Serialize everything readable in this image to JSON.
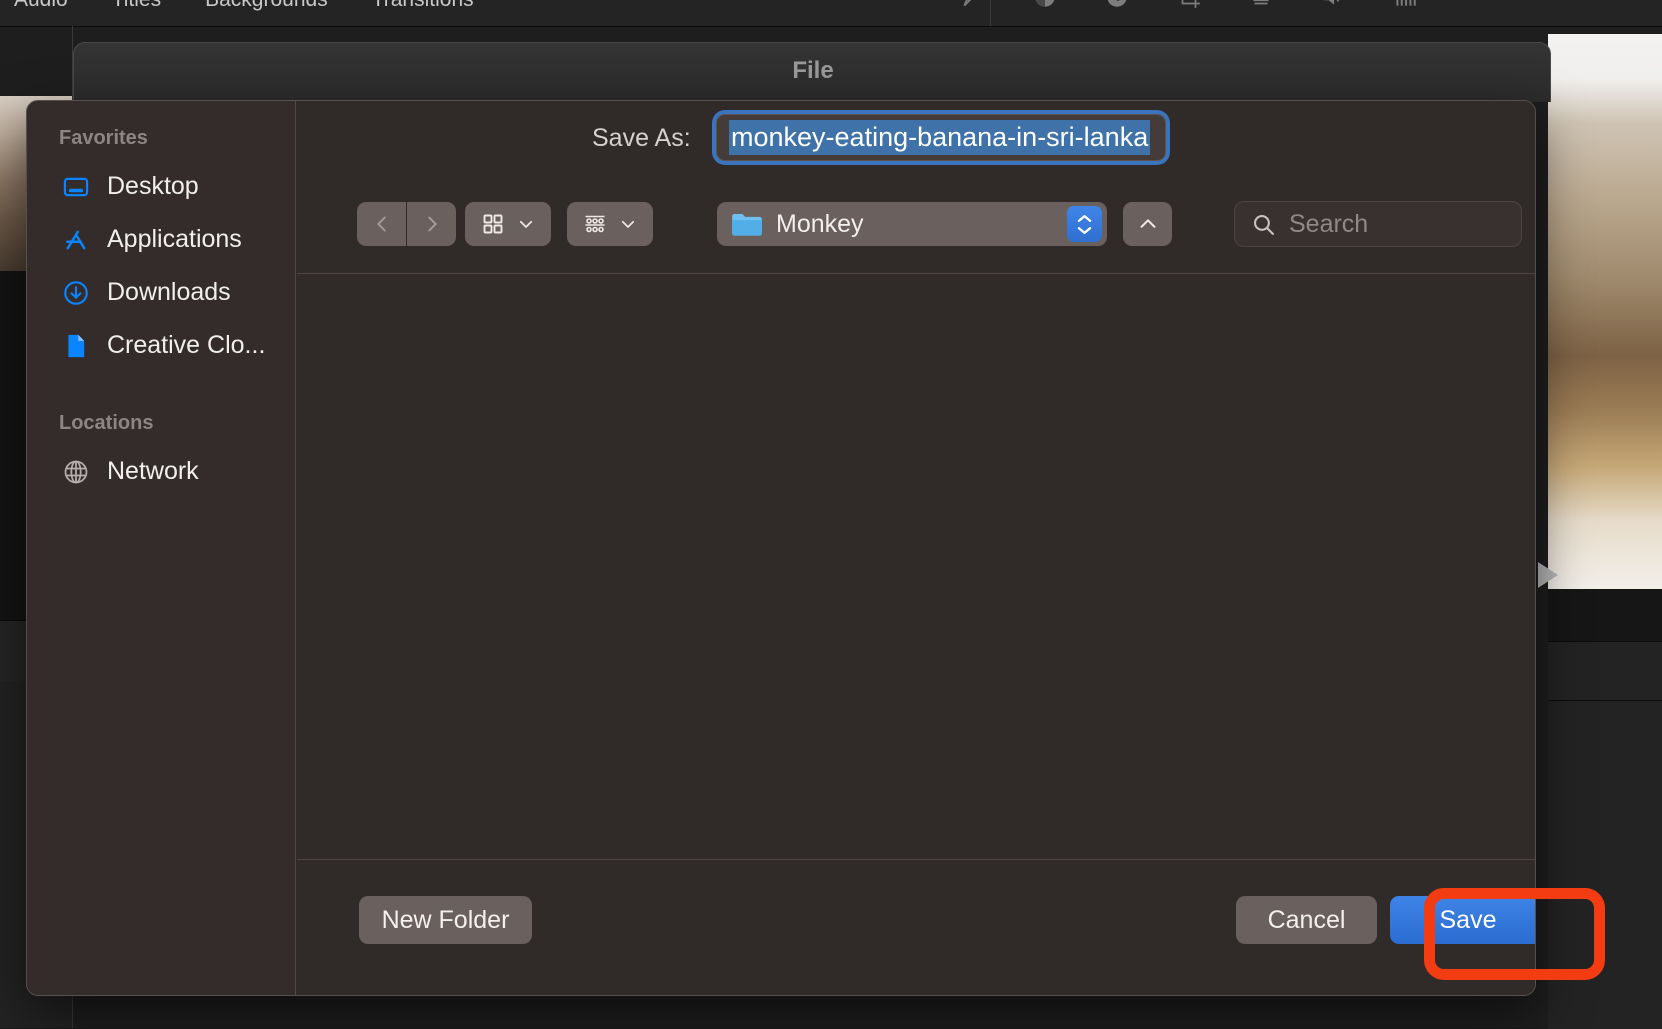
{
  "background_app": {
    "menu_tabs": [
      "Audio",
      "Titles",
      "Backgrounds",
      "Transitions"
    ],
    "toolbar_icons": [
      "magic-wand-icon",
      "color-balance-icon",
      "color-correction-icon",
      "crop-icon",
      "stabilization-icon",
      "volume-icon",
      "equalizer-icon"
    ]
  },
  "window": {
    "title": "File"
  },
  "sidebar": {
    "groups": [
      {
        "title": "Favorites",
        "items": [
          {
            "label": "Desktop",
            "icon": "desktop-icon"
          },
          {
            "label": "Applications",
            "icon": "applications-icon"
          },
          {
            "label": "Downloads",
            "icon": "downloads-icon"
          },
          {
            "label": "Creative Clo...",
            "icon": "document-icon"
          }
        ]
      },
      {
        "title": "Locations",
        "items": [
          {
            "label": "Network",
            "icon": "globe-icon"
          }
        ]
      }
    ]
  },
  "save_as": {
    "label": "Save As:",
    "value": "monkey-eating-banana-in-sri-lanka",
    "selected": true
  },
  "toolbar": {
    "back_icon": "chevron-left-icon",
    "forward_icon": "chevron-right-icon",
    "view_icon": "grid-view-icon",
    "view_chevron": "chevron-down-icon",
    "group_icon": "list-group-icon",
    "group_chevron": "chevron-down-icon",
    "folder_icon": "folder-icon",
    "folder_name": "Monkey",
    "stepper_icon": "up-down-stepper-icon",
    "up_icon": "chevron-up-icon",
    "search_icon": "search-icon",
    "search_placeholder": "Search"
  },
  "footer": {
    "new_folder_label": "New Folder",
    "cancel_label": "Cancel",
    "save_label": "Save"
  },
  "annotation": {
    "target": "save-button",
    "color": "#f43c13"
  },
  "colors": {
    "accent_blue": "#2f6fd0",
    "dialog_bg": "#302a29",
    "sidebar_bg": "#332c2b",
    "selection_blue": "#3e72a8",
    "annotation_red": "#f43c13"
  }
}
